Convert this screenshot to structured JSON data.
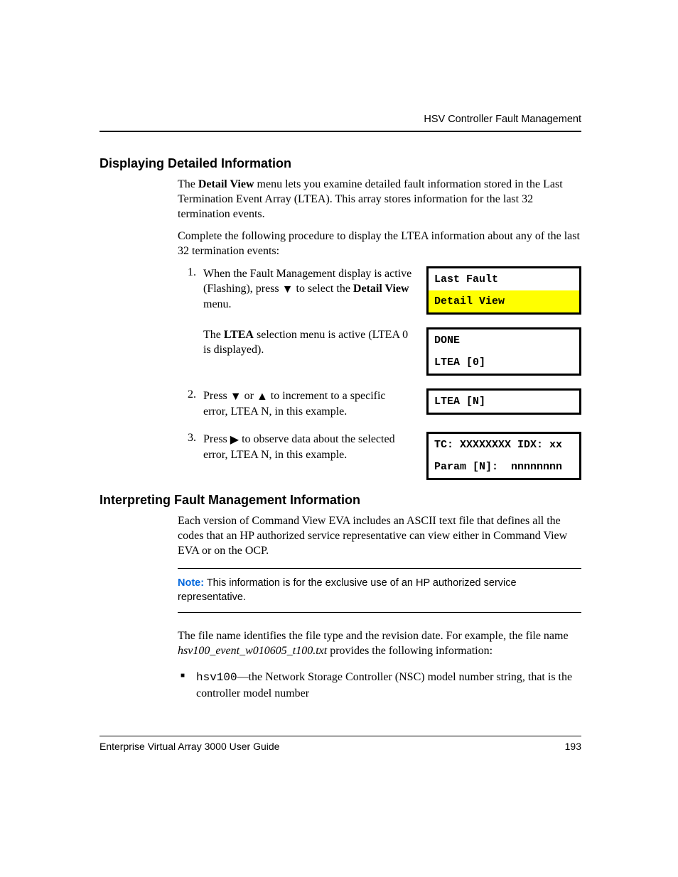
{
  "header": {
    "running_title": "HSV Controller Fault Management"
  },
  "section1": {
    "title": "Displaying Detailed Information",
    "p1_a": "The ",
    "p1_bold": "Detail View",
    "p1_b": " menu lets you examine detailed fault information stored in the Last Termination Event Array (LTEA). This array stores information for the last 32 termination events.",
    "p2": "Complete the following procedure to display the LTEA information about any of the last 32 termination events:"
  },
  "steps": [
    {
      "num": "1.",
      "t1": "When the Fault Management display is active (Flashing), press ",
      "t2": " to select the ",
      "t_bold": "Detail View",
      "t3": " menu.",
      "lcd": [
        {
          "text": "Last Fault",
          "hl": false
        },
        {
          "text": "Detail View",
          "hl": true
        }
      ]
    },
    {
      "num": "",
      "t1": "The ",
      "t_bold": "LTEA",
      "t2": " selection menu is active (LTEA 0 is displayed).",
      "lcd": [
        {
          "text": "DONE",
          "hl": false
        },
        {
          "text": "LTEA [0]",
          "hl": false
        }
      ]
    },
    {
      "num": "2.",
      "t1": "Press ",
      "t2": " or ",
      "t3": " to increment to a specific error, LTEA N, in this example.",
      "lcd": [
        {
          "text": "LTEA [N]",
          "hl": false
        }
      ]
    },
    {
      "num": "3.",
      "t1": "Press ",
      "t2": " to observe data about the selected error, LTEA N, in this example.",
      "lcd": [
        {
          "text": "TC: XXXXXXXX IDX: xx",
          "hl": false
        },
        {
          "text": "Param [N]:  nnnnnnnn",
          "hl": false
        }
      ]
    }
  ],
  "section2": {
    "title": "Interpreting Fault Management Information",
    "p1": "Each version of Command View EVA includes an ASCII text file that defines all the codes that an HP authorized service representative can view either in Command View EVA or on the OCP.",
    "note_label": "Note:",
    "note_text": "  This information is for the exclusive use of an HP authorized service representative.",
    "p2_a": "The file name identifies the file type and the revision date. For example, the file name ",
    "p2_ital": "hsv100_event_w010605_t100.txt",
    "p2_b": " provides the following information:",
    "bullet_code": "hsv100",
    "bullet_rest": "—the Network Storage Controller (NSC) model number string, that is the controller model number"
  },
  "footer": {
    "doc_title": "Enterprise Virtual Array 3000 User Guide",
    "page_num": "193"
  }
}
